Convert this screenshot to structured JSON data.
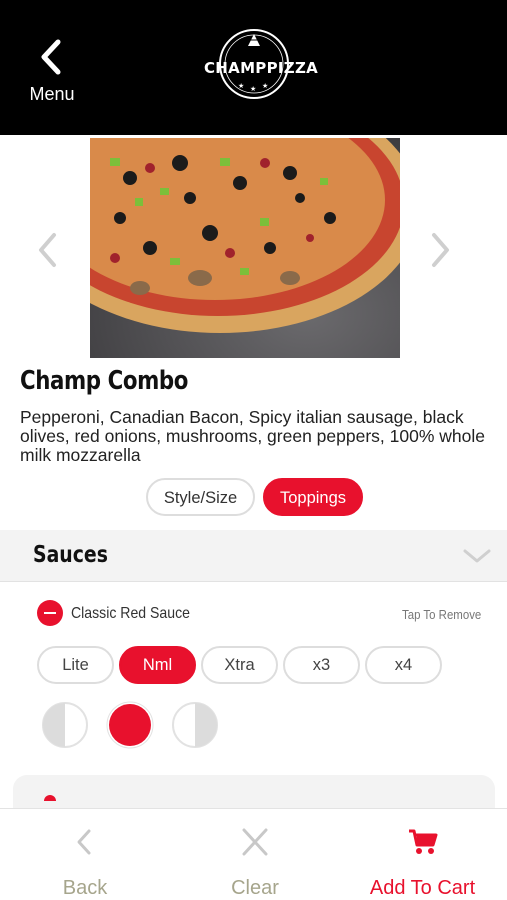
{
  "header": {
    "menu_label": "Menu",
    "logo_text": "CHAMPPIZZA"
  },
  "product": {
    "name": "Champ Combo",
    "description": "Pepperoni, Canadian Bacon, Spicy italian sausage, black olives, red onions, mushrooms, green peppers, 100% whole milk mozzarella"
  },
  "tabs": [
    {
      "label": "Style/Size",
      "active": false
    },
    {
      "label": "Toppings",
      "active": true
    }
  ],
  "section": {
    "title": "Sauces"
  },
  "sauce": {
    "name": "Classic Red Sauce",
    "remove_hint": "Tap To Remove",
    "amounts": [
      "Lite",
      "Nml",
      "Xtra",
      "x3",
      "x4"
    ],
    "selected_amount": "Nml",
    "coverage_options": [
      "left-half",
      "whole",
      "right-half"
    ],
    "selected_coverage": "whole"
  },
  "bottom_bar": {
    "back_label": "Back",
    "clear_label": "Clear",
    "cart_label": "Add To Cart"
  },
  "colors": {
    "accent": "#e8112d",
    "header_bg": "#000000",
    "section_bg": "#f3f3f3",
    "muted_label": "#a6a58c"
  }
}
